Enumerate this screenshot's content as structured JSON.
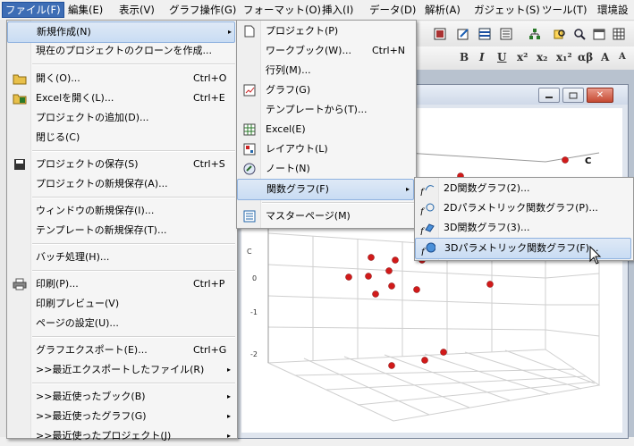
{
  "menubar": {
    "items": [
      "ファイル(F)",
      "編集(E)",
      "表示(V)",
      "グラフ操作(G)",
      "フォーマット(O)",
      "挿入(I)",
      "データ(D)",
      "解析(A)",
      "ガジェット(S)",
      "ツール(T)",
      "環境設"
    ]
  },
  "file_menu": {
    "items": [
      {
        "label": "新規作成(N)",
        "shortcut": "",
        "arrow": "▸"
      },
      {
        "label": "現在のプロジェクトのクローンを作成...",
        "shortcut": ""
      },
      {
        "label": "開く(O)...",
        "shortcut": "Ctrl+O"
      },
      {
        "label": "Excelを開く(L)...",
        "shortcut": "Ctrl+E"
      },
      {
        "label": "プロジェクトの追加(D)...",
        "shortcut": ""
      },
      {
        "label": "閉じる(C)",
        "shortcut": ""
      },
      {
        "label": "プロジェクトの保存(S)",
        "shortcut": "Ctrl+S"
      },
      {
        "label": "プロジェクトの新規保存(A)...",
        "shortcut": ""
      },
      {
        "label": "ウィンドウの新規保存(I)...",
        "shortcut": ""
      },
      {
        "label": "テンプレートの新規保存(T)...",
        "shortcut": ""
      },
      {
        "label": "バッチ処理(H)...",
        "shortcut": ""
      },
      {
        "label": "印刷(P)...",
        "shortcut": "Ctrl+P"
      },
      {
        "label": "印刷プレビュー(V)",
        "shortcut": ""
      },
      {
        "label": "ページの設定(U)...",
        "shortcut": ""
      },
      {
        "label": "グラフエクスポート(E)...",
        "shortcut": "Ctrl+G"
      },
      {
        "label": ">>最近エクスポートしたファイル(R)",
        "shortcut": "",
        "arrow": "▸"
      },
      {
        "label": ">>最近使ったブック(B)",
        "shortcut": "",
        "arrow": "▸"
      },
      {
        "label": ">>最近使ったグラフ(G)",
        "shortcut": "",
        "arrow": "▸"
      },
      {
        "label": ">>最近使ったプロジェクト(J)",
        "shortcut": "",
        "arrow": "▸"
      }
    ]
  },
  "new_submenu": {
    "items": [
      {
        "label": "プロジェクト(P)",
        "shortcut": ""
      },
      {
        "label": "ワークブック(W)...",
        "shortcut": "Ctrl+N"
      },
      {
        "label": "行列(M)...",
        "shortcut": ""
      },
      {
        "label": "グラフ(G)",
        "shortcut": ""
      },
      {
        "label": "テンプレートから(T)...",
        "shortcut": ""
      },
      {
        "label": "Excel(E)",
        "shortcut": ""
      },
      {
        "label": "レイアウト(L)",
        "shortcut": ""
      },
      {
        "label": "ノート(N)",
        "shortcut": ""
      },
      {
        "label": "関数グラフ(F)",
        "shortcut": "",
        "arrow": "▸"
      },
      {
        "label": "マスターページ(M)",
        "shortcut": ""
      }
    ]
  },
  "function_submenu": {
    "items": [
      {
        "label": "2D関数グラフ(2)..."
      },
      {
        "label": "2Dパラメトリック関数グラフ(P)..."
      },
      {
        "label": "3D関数グラフ(3)..."
      },
      {
        "label": "3Dパラメトリック関数グラフ(F)..."
      }
    ]
  },
  "toolbar2": {
    "buttons": [
      "B",
      "I",
      "U",
      "x²",
      "x₂",
      "x₁²",
      "αβ",
      "A",
      "A"
    ]
  },
  "graph": {
    "legend_letter": "C",
    "z_ticks": [
      "0",
      "-1",
      "-2"
    ]
  },
  "colors": {
    "accent": "#3d6db5",
    "highlight": "#c9dcf3",
    "point": "#d11a1a"
  }
}
